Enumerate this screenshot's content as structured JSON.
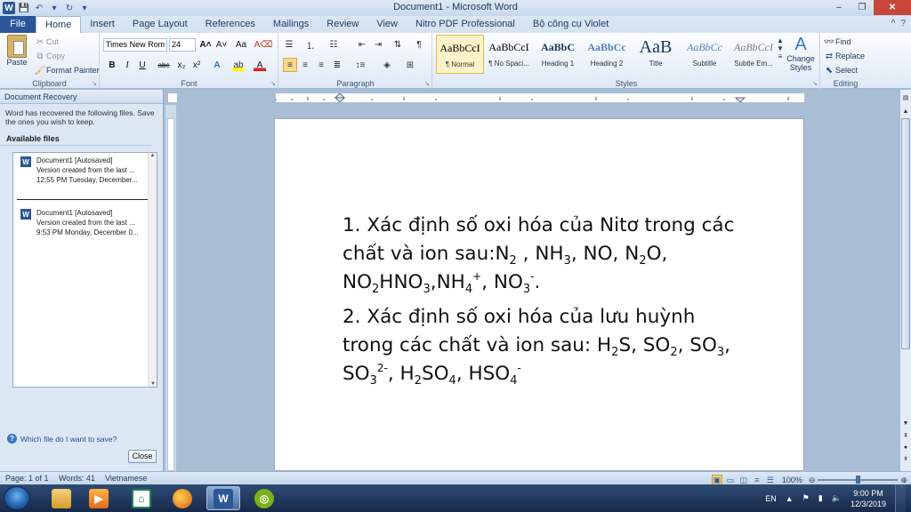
{
  "window": {
    "title": "Document1 - Microsoft Word",
    "controls": {
      "minimize": "–",
      "restore": "❐",
      "close": "✕"
    }
  },
  "ribbon_tabs": [
    {
      "label": "File"
    },
    {
      "label": "Home"
    },
    {
      "label": "Insert"
    },
    {
      "label": "Page Layout"
    },
    {
      "label": "References"
    },
    {
      "label": "Mailings"
    },
    {
      "label": "Review"
    },
    {
      "label": "View"
    },
    {
      "label": "Nitro PDF Professional"
    },
    {
      "label": "Bộ công cụ Violet"
    }
  ],
  "clipboard": {
    "paste": "Paste",
    "cut": "Cut",
    "copy": "Copy",
    "format_painter": "Format Painter",
    "group_label": "Clipboard"
  },
  "font": {
    "name": "Times New Rom",
    "size": "24",
    "group_label": "Font"
  },
  "paragraph": {
    "group_label": "Paragraph"
  },
  "styles": {
    "group_label": "Styles",
    "items": [
      {
        "preview": "AaBbCcI",
        "name": "¶ Normal"
      },
      {
        "preview": "AaBbCcI",
        "name": "¶ No Spaci..."
      },
      {
        "preview": "AaBbC",
        "name": "Heading 1"
      },
      {
        "preview": "AaBbCc",
        "name": "Heading 2"
      },
      {
        "preview": "AaB",
        "name": "Title"
      },
      {
        "preview": "AaBbCc",
        "name": "Subtitle"
      },
      {
        "preview": "AaBbCcI",
        "name": "Subtle Em..."
      }
    ],
    "change_styles": "Change Styles"
  },
  "editing": {
    "find": "Find",
    "replace": "Replace",
    "select": "Select",
    "group_label": "Editing"
  },
  "recovery_pane": {
    "title": "Document Recovery",
    "description": "Word has recovered the following files.  Save the ones you wish to keep.",
    "available_label": "Available files",
    "files": [
      {
        "name": "Document1  [Autosaved]",
        "line1": "Version created from the last ...",
        "line2": "12:55 PM Tuesday, December..."
      },
      {
        "name": "Document1  [Autosaved]",
        "line1": "Version created from the last ...",
        "line2": "9:53 PM Monday, December 0..."
      }
    ],
    "help_link": "Which file do I want to save?",
    "close_button": "Close"
  },
  "document": {
    "p1_pre": "1. Xác định số oxi hóa của Nitơ trong các chất và ion sau:N",
    "p2_pre": "2. Xác định số oxi hóa của lưu huỳnh trong các chất và ion sau: H"
  },
  "statusbar": {
    "page": "Page: 1 of 1",
    "words": "Words: 41",
    "language": "Vietnamese",
    "zoom": "100%",
    "zoom_fraction": 0.5
  },
  "taskbar": {
    "language": "EN",
    "time": "9:00 PM",
    "date": "12/3/2019"
  }
}
